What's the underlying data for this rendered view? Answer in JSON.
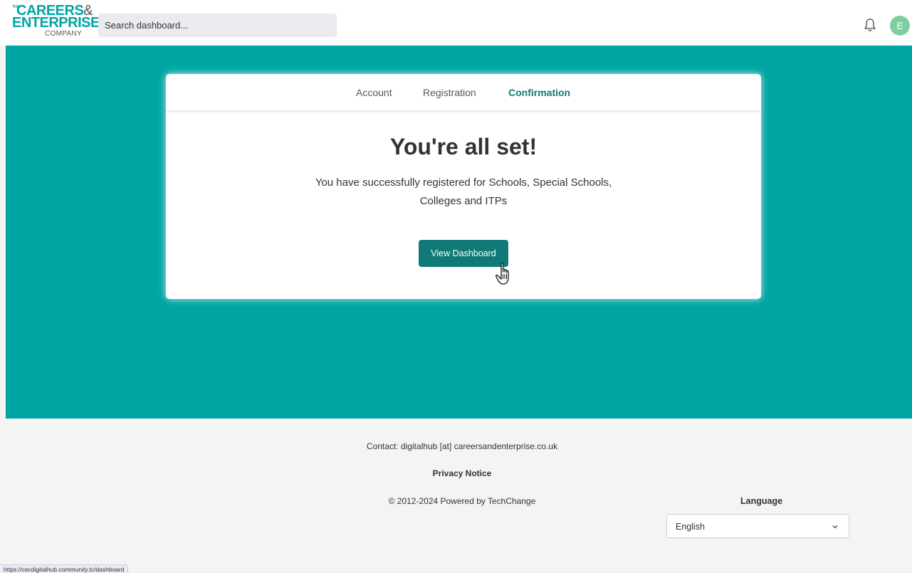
{
  "header": {
    "logo": {
      "the": "THE",
      "line1": "CAREERS",
      "amp": "&",
      "line2": "ENTERPRISE",
      "line3": "COMPANY"
    },
    "search": {
      "placeholder": "Search dashboard..."
    },
    "bell_icon": "bell-icon",
    "avatar_initial": "E",
    "avatar_color": "#7ecfa0"
  },
  "colors": {
    "brand_teal": "#00a5a3",
    "button_dark_teal": "#117a78"
  },
  "card": {
    "steps": [
      {
        "label": "Account",
        "active": false
      },
      {
        "label": "Registration",
        "active": false
      },
      {
        "label": "Confirmation",
        "active": true
      }
    ],
    "title": "You're all set!",
    "message": "You have successfully registered for Schools, Special Schools, Colleges and ITPs",
    "button_label": "View Dashboard"
  },
  "footer": {
    "contact": "Contact:  digitalhub [at] careersandenterprise.co.uk",
    "privacy": "Privacy Notice",
    "copyright": "© 2012-2024  Powered by TechChange",
    "language_label": "Language",
    "language_value": "English"
  },
  "status_url": "https://cecdigitalhub.community.tc/dashboard"
}
